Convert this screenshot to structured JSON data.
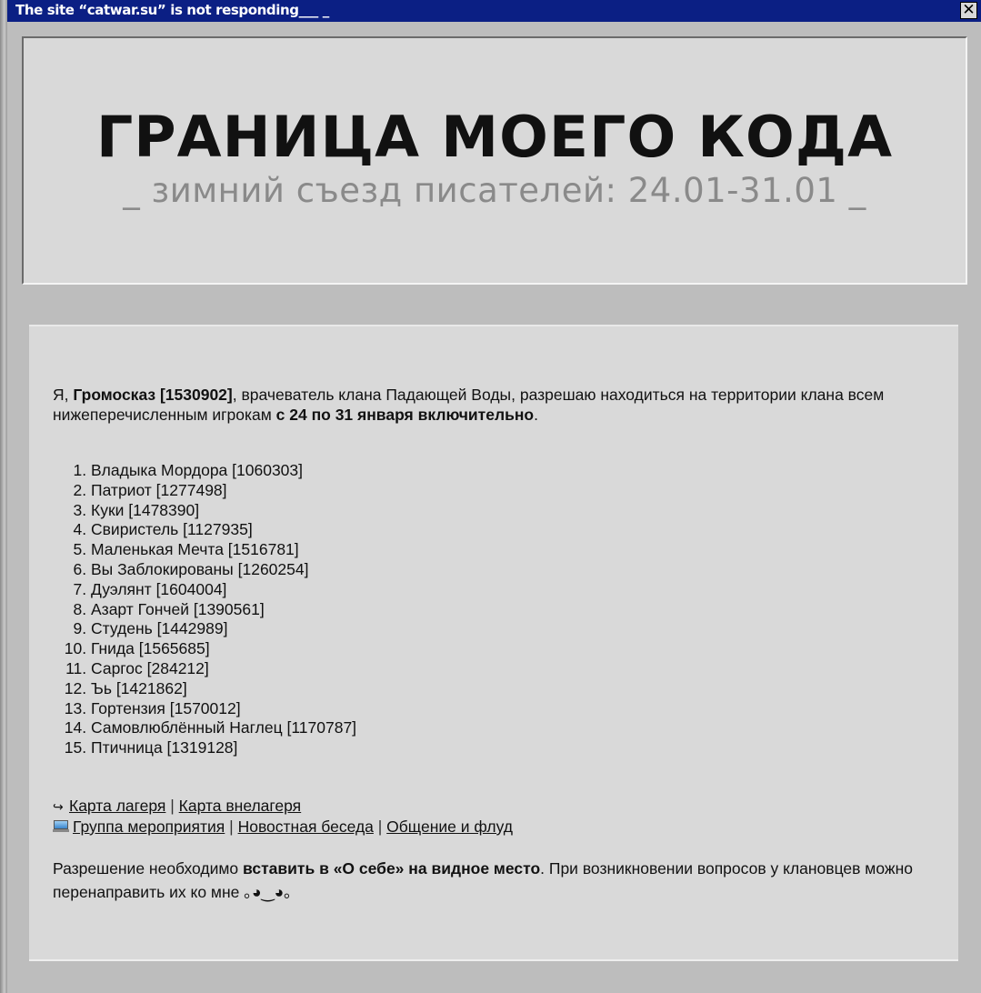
{
  "window": {
    "title": "The site “catwar.su” is not responding___ _",
    "close_label": "✕"
  },
  "header": {
    "title": "ГРАНИЦА МОЕГО КОДА",
    "subtitle": "_ зимний съезд писателей: 24.01-31.01 _"
  },
  "intro": {
    "p1": "Я, ",
    "name": "Громосказ [1530902]",
    "p2": ", врачеватель клана Падающей Воды, разрешаю находиться на территории клана всем нижеперечисленным игрокам ",
    "period": "с 24 по 31 января включительно",
    "p3": "."
  },
  "players": [
    "Владыка Мордора [1060303]",
    "Патриот [1277498]",
    "Куки [1478390]",
    "Свиристель [1127935]",
    "Маленькая Мечта [1516781]",
    "Вы Заблокированы [1260254]",
    "Дуэлянт [1604004]",
    "Азарт Гончей [1390561]",
    "Студень [1442989]",
    "Гнида [1565685]",
    "Саргос [284212]",
    "Ъь [1421862]",
    "Гортензия [1570012]",
    "Самовлюблённый Наглец [1170787]",
    "Птичница [1319128]"
  ],
  "links": {
    "arrow_icon": "↪",
    "separator": " | ",
    "row1": [
      "Карта лагеря",
      "Карта внелагеря"
    ],
    "row2": [
      "Группа мероприятия",
      "Новостная беседа",
      "Общение и флуд"
    ]
  },
  "note": {
    "p1": "Разрешение необходимо ",
    "bold": "вставить в «О себе» на видное место",
    "p2": ". При возникновении вопросов у клановцев можно перенаправить их ко мне ",
    "emoticon": "｡◕‿◕｡"
  },
  "colors": {
    "titlebar": "#0b1f84",
    "background": "#bdbdbd",
    "panel": "#d9d9d9"
  }
}
